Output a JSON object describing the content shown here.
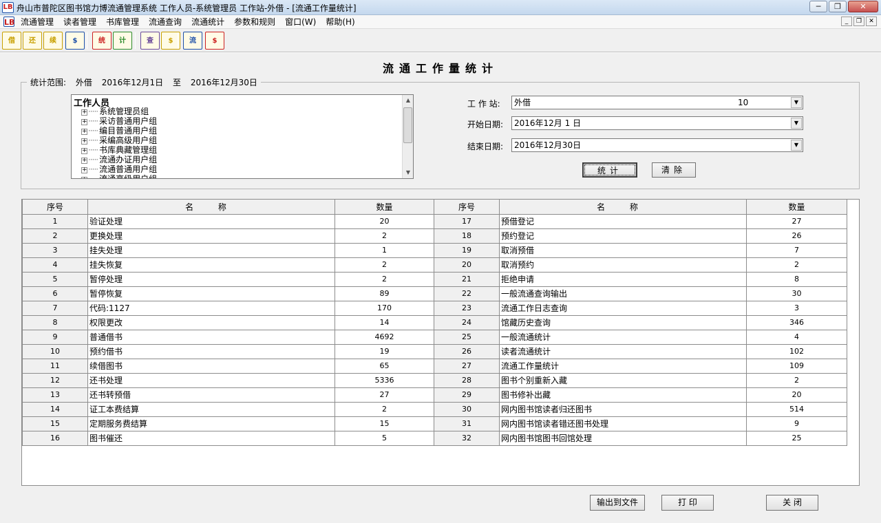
{
  "window": {
    "app_icon_text": "LB",
    "title": "舟山市普陀区图书馆力博流通管理系统 工作人员-系统管理员 工作站-外借 - [流通工作量统计]",
    "minimize_label": "─",
    "maximize_label": "❐",
    "close_label": "✕"
  },
  "menubar": {
    "icon_text": "LB",
    "items": [
      "流通管理",
      "读者管理",
      "书库管理",
      "流通查询",
      "流通统计",
      "参数和规则",
      "窗口(W)",
      "帮助(H)"
    ],
    "mdi_minimize": "_",
    "mdi_restore": "❐",
    "mdi_close": "✕"
  },
  "toolbar": {
    "buttons": [
      {
        "name": "借",
        "color": "#c8a000"
      },
      {
        "name": "还",
        "color": "#c8a000"
      },
      {
        "name": "续",
        "color": "#c8a000"
      },
      {
        "name": "$",
        "color": "#1c4fa8"
      },
      {
        "name": "统",
        "color": "#cc2020"
      },
      {
        "name": "计",
        "color": "#2a8a2a"
      },
      {
        "name": "查",
        "color": "#6b4b9a"
      },
      {
        "name": "$",
        "color": "#c8a000"
      },
      {
        "name": "流",
        "color": "#1c4fa8"
      },
      {
        "name": "$",
        "color": "#cc2020"
      }
    ]
  },
  "form": {
    "title": "流通工作量统计",
    "range_label": "统计范围:",
    "range_station": "外借",
    "range_start": "2016年12月1日",
    "range_to": "至",
    "range_end": "2016年12月30日",
    "tree": {
      "root": "工作人员",
      "nodes": [
        "系统管理员组",
        "采访普通用户组",
        "编目普通用户组",
        "采编高级用户组",
        "书库典藏管理组",
        "流通办证用户组",
        "流通普通用户组",
        "流通高级用户组"
      ]
    },
    "station_label": "工 作 站:",
    "station_value": "外借",
    "station_num": "10",
    "start_label": "开始日期:",
    "start_value": "2016年12月 1 日",
    "end_label": "结束日期:",
    "end_value": "2016年12月30日",
    "stat_button": "统计",
    "clear_button": "清除"
  },
  "grid": {
    "headers": [
      "序号",
      "名  称",
      "数量",
      "序号",
      "名  称",
      "数量"
    ],
    "rows": [
      {
        "n1": "1",
        "name1": "验证处理",
        "q1": "20",
        "n2": "17",
        "name2": "预借登记",
        "q2": "27"
      },
      {
        "n1": "2",
        "name1": "更换处理",
        "q1": "2",
        "n2": "18",
        "name2": "预约登记",
        "q2": "26"
      },
      {
        "n1": "3",
        "name1": "挂失处理",
        "q1": "1",
        "n2": "19",
        "name2": "取消预借",
        "q2": "7"
      },
      {
        "n1": "4",
        "name1": "挂失恢复",
        "q1": "2",
        "n2": "20",
        "name2": "取消预约",
        "q2": "2"
      },
      {
        "n1": "5",
        "name1": "暂停处理",
        "q1": "2",
        "n2": "21",
        "name2": "拒绝申请",
        "q2": "8"
      },
      {
        "n1": "6",
        "name1": "暂停恢复",
        "q1": "89",
        "n2": "22",
        "name2": "一般流通查询输出",
        "q2": "30"
      },
      {
        "n1": "7",
        "name1": "代码:1127",
        "q1": "170",
        "n2": "23",
        "name2": "流通工作日志查询",
        "q2": "3"
      },
      {
        "n1": "8",
        "name1": "权限更改",
        "q1": "14",
        "n2": "24",
        "name2": "馆藏历史查询",
        "q2": "346"
      },
      {
        "n1": "9",
        "name1": "普通借书",
        "q1": "4692",
        "n2": "25",
        "name2": "一般流通统计",
        "q2": "4"
      },
      {
        "n1": "10",
        "name1": "预约借书",
        "q1": "19",
        "n2": "26",
        "name2": "读者流通统计",
        "q2": "102"
      },
      {
        "n1": "11",
        "name1": "续借图书",
        "q1": "65",
        "n2": "27",
        "name2": "流通工作量统计",
        "q2": "109"
      },
      {
        "n1": "12",
        "name1": "还书处理",
        "q1": "5336",
        "n2": "28",
        "name2": "图书个别重新入藏",
        "q2": "2"
      },
      {
        "n1": "13",
        "name1": "还书转预借",
        "q1": "27",
        "n2": "29",
        "name2": "图书修补出藏",
        "q2": "20"
      },
      {
        "n1": "14",
        "name1": "证工本费结算",
        "q1": "2",
        "n2": "30",
        "name2": "网内图书馆读者归还图书",
        "q2": "514"
      },
      {
        "n1": "15",
        "name1": "定期服务费结算",
        "q1": "15",
        "n2": "31",
        "name2": "网内图书馆读者错还图书处理",
        "q2": "9"
      },
      {
        "n1": "16",
        "name1": "图书催还",
        "q1": "5",
        "n2": "32",
        "name2": "网内图书馆图书回馆处理",
        "q2": "25"
      }
    ]
  },
  "footer": {
    "export_button": "输出到文件",
    "print_button": "打 印",
    "close_button": "关 闭"
  }
}
